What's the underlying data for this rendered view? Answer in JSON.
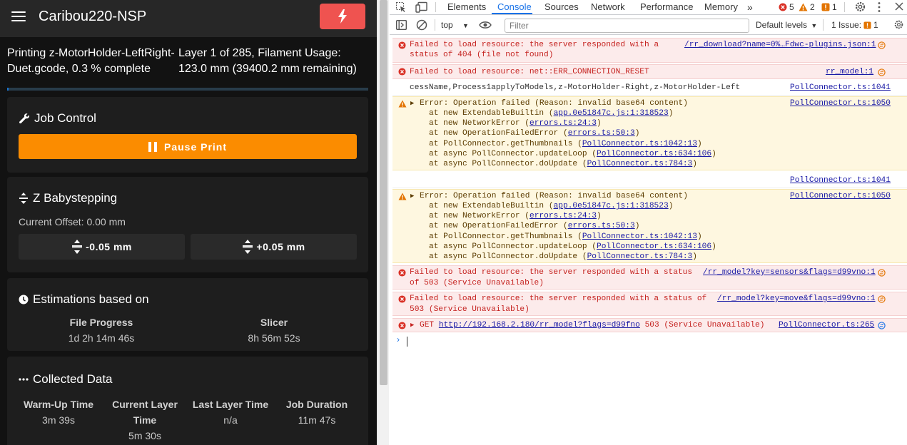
{
  "app": {
    "title": "Caribou220-NSP",
    "status_left": "Printing z-MotorHolder-LeftRight-Duet.gcode, 0.3 % complete",
    "status_right": "Layer 1 of 285, Filament Usage: 123.0 mm (39400.2 mm remaining)",
    "progress_fraction": 0.003,
    "accent_color": "#1976d2",
    "job_control": {
      "title": "Job Control",
      "pause_label": "Pause Print"
    },
    "babystepping": {
      "title": "Z Babystepping",
      "offset_label": "Current Offset: 0.00 mm",
      "minus_label": "-0.05 mm",
      "plus_label": "+0.05 mm"
    },
    "estimations": {
      "title": "Estimations based on",
      "file_progress": {
        "label": "File Progress",
        "value": "1d 2h 14m 46s"
      },
      "slicer": {
        "label": "Slicer",
        "value": "8h 56m 52s"
      }
    },
    "collected": {
      "title": "Collected Data",
      "warmup": {
        "label": "Warm-Up Time",
        "value": "3m 39s"
      },
      "current_layer": {
        "label_1": "Current Layer",
        "label_2": "Time",
        "value": "5m 30s"
      },
      "last_layer": {
        "label": "Last Layer Time",
        "value": "n/a"
      },
      "duration": {
        "label": "Job Duration",
        "value": "11m 47s"
      }
    }
  },
  "devtools": {
    "tabs": [
      "Elements",
      "Console",
      "Sources",
      "Network",
      "Performance",
      "Memory"
    ],
    "active_tab": "Console",
    "error_count": "5",
    "warning_count": "2",
    "issue_count": "1",
    "context": "top",
    "filter_placeholder": "Filter",
    "levels": "Default levels",
    "issues_label": "1 Issue:",
    "issues_num": "1",
    "messages": {
      "m1_line1": "Failed to load resource: the server responded with a",
      "m1_line2": "status of 404 (file not found)",
      "m1_src": "/rr_download?name=0%…Fdwc-plugins.json:1",
      "m2_text": "Failed to load resource: net::ERR_CONNECTION_RESET",
      "m2_src": "rr_model:1",
      "m3_text": "cessName,Process1applyToModels,z-MotorHolder-Right,z-MotorHolder-Left",
      "m3_src": "PollConnector.ts:1041",
      "w1_head": "Error: Operation failed (Reason: invalid base64 content)",
      "w1_src": "PollConnector.ts:1050",
      "w1_s1a": "at new ExtendableBuiltin (",
      "w1_s1b": "app.0e51847c.js:1:318523",
      "w1_s1c": ")",
      "w1_s2a": "at new NetworkError (",
      "w1_s2b": "errors.ts:24:3",
      "w1_s2c": ")",
      "w1_s3a": "at new OperationFailedError (",
      "w1_s3b": "errors.ts:50:3",
      "w1_s3c": ")",
      "w1_s4a": "at PollConnector.getThumbnails (",
      "w1_s4b": "PollConnector.ts:1042:13",
      "w1_s4c": ")",
      "w1_s5a": "at async PollConnector.updateLoop (",
      "w1_s5b": "PollConnector.ts:634:106",
      "w1_s5c": ")",
      "w1_s6a": "at async PollConnector.doUpdate (",
      "w1_s6b": "PollConnector.ts:784:3",
      "w1_s6c": ")",
      "m4_src": "PollConnector.ts:1041",
      "e3_line1": "Failed to load resource: the server responded with a status",
      "e3_line2": "of 503 (Service Unavailable)",
      "e3_src": "/rr_model?key=sensors&flags=d99vno:1",
      "e4_line1": "Failed to load resource: the server responded with a status of",
      "e4_line2": "503 (Service Unavailable)",
      "e4_src": "/rr_model?key=move&flags=d99vno:1",
      "e5_method": "GET",
      "e5_url": "http://192.168.2.180/rr_model?flags=d99fno",
      "e5_status": "503 (Service Unavailable)",
      "e5_src": "PollConnector.ts:265"
    }
  }
}
